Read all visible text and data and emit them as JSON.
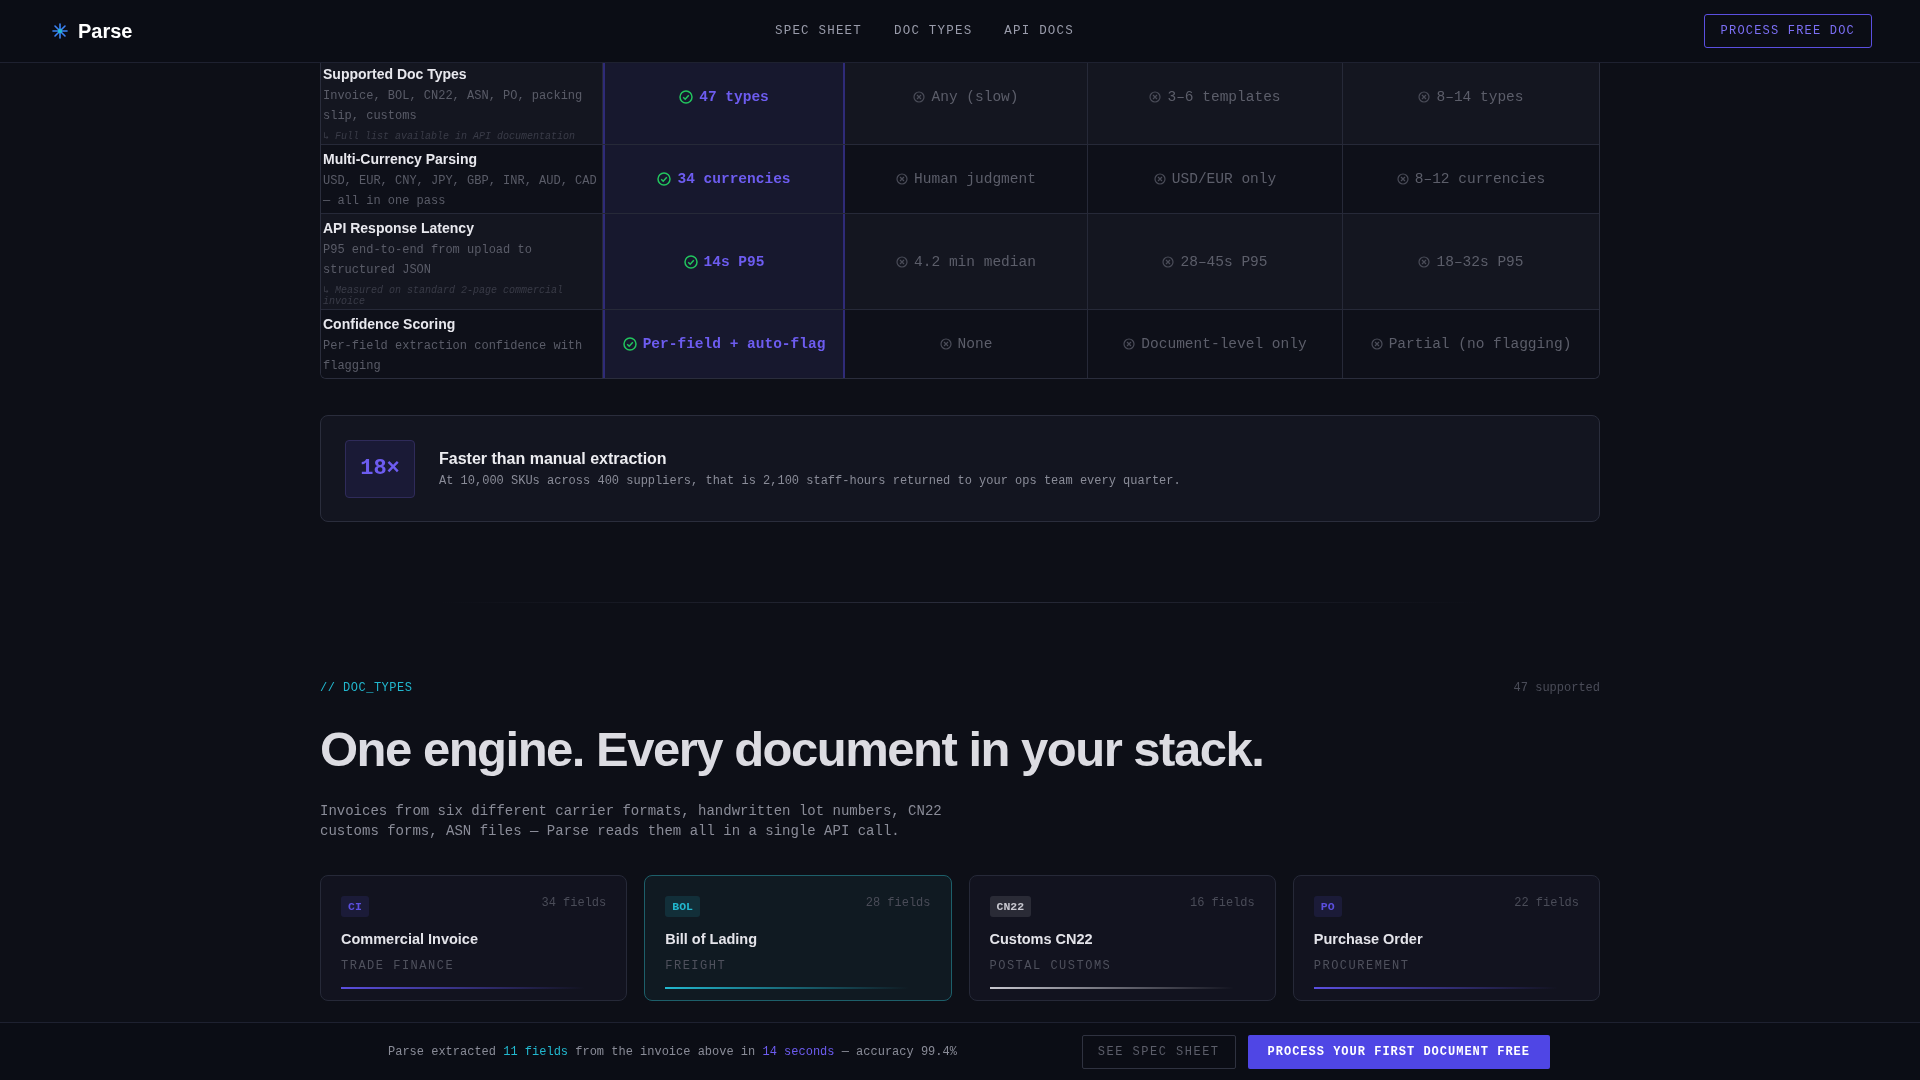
{
  "nav": {
    "brand": "Parse",
    "links": [
      "SPEC SHEET",
      "DOC TYPES",
      "API DOCS"
    ],
    "cta": "PROCESS FREE DOC"
  },
  "comparison": {
    "rows": [
      {
        "label": "Supported Doc Types",
        "description": "Invoice, BOL, CN22, ASN, PO, packing slip, customs",
        "note": "↳ Full list available in API documentation",
        "cells": [
          {
            "kind": "win",
            "text": "47 types"
          },
          {
            "kind": "lose",
            "text": "Any (slow)"
          },
          {
            "kind": "lose",
            "text": "3–6 templates"
          },
          {
            "kind": "lose",
            "text": "8–14 types"
          }
        ]
      },
      {
        "label": "Multi-Currency Parsing",
        "description": "USD, EUR, CNY, JPY, GBP, INR, AUD, CAD — all in one pass",
        "cells": [
          {
            "kind": "win",
            "text": "34 currencies"
          },
          {
            "kind": "lose",
            "text": "Human judgment"
          },
          {
            "kind": "lose",
            "text": "USD/EUR only"
          },
          {
            "kind": "lose",
            "text": "8–12 currencies"
          }
        ]
      },
      {
        "label": "API Response Latency",
        "description": "P95 end-to-end from upload to structured JSON",
        "note": "↳ Measured on standard 2-page commercial invoice",
        "cells": [
          {
            "kind": "win",
            "text": "14s P95"
          },
          {
            "kind": "lose",
            "text": "4.2 min median"
          },
          {
            "kind": "lose",
            "text": "28–45s P95"
          },
          {
            "kind": "lose",
            "text": "18–32s P95"
          }
        ]
      },
      {
        "label": "Confidence Scoring",
        "description": "Per-field extraction confidence with flagging",
        "cells": [
          {
            "kind": "win",
            "text": "Per-field + auto-flag"
          },
          {
            "kind": "lose",
            "text": "None"
          },
          {
            "kind": "lose",
            "text": "Document-level only"
          },
          {
            "kind": "lose",
            "text": "Partial (no flagging)"
          }
        ]
      }
    ]
  },
  "stat": {
    "value": "18×",
    "title": "Faster than manual extraction",
    "text": "At 10,000 SKUs across 400 suppliers, that is 2,100 staff-hours returned to your ops team every quarter."
  },
  "doc_types": {
    "eyebrow": "// DOC_TYPES",
    "count": "47 supported",
    "heading": "One engine. Every document in your stack.",
    "intro": "Invoices from six different carrier formats, handwritten lot numbers, CN22 customs forms, ASN files — Parse reads them all in a single API call.",
    "cards": [
      {
        "code": "CI",
        "fields": "34 fields",
        "title": "Commercial Invoice",
        "category": "TRADE FINANCE",
        "color": "#5b4fe0",
        "selected": false
      },
      {
        "code": "BOL",
        "fields": "28 fields",
        "title": "Bill of Lading",
        "category": "FREIGHT",
        "color": "#22b8cf",
        "selected": true
      },
      {
        "code": "CN22",
        "fields": "16 fields",
        "title": "Customs CN22",
        "category": "POSTAL CUSTOMS",
        "color": "#c8c8d0",
        "selected": false
      },
      {
        "code": "PO",
        "fields": "22 fields",
        "title": "Purchase Order",
        "category": "PROCUREMENT",
        "color": "#5b4fe0",
        "selected": false
      }
    ]
  },
  "bottom_bar": {
    "message": [
      {
        "kind": "plain",
        "text": "Parse extracted "
      },
      {
        "kind": "accent",
        "text": "11 fields"
      },
      {
        "kind": "plain",
        "text": " from the invoice above in "
      },
      {
        "kind": "highlight",
        "text": "14 seconds"
      },
      {
        "kind": "plain",
        "text": " — accuracy 99.4%"
      }
    ],
    "secondary": "SEE SPEC SHEET",
    "primary": "PROCESS YOUR FIRST DOCUMENT FREE"
  }
}
